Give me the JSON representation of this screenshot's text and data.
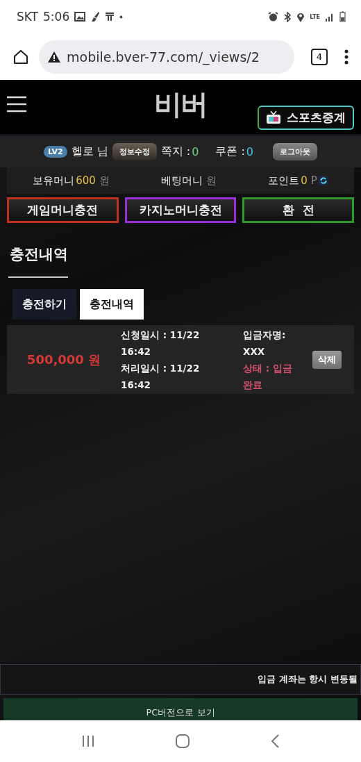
{
  "status_bar": {
    "carrier": "SKT",
    "time": "5:06",
    "network": "LTE"
  },
  "browser": {
    "url": "mobile.bver-77.com/_views/2",
    "tab_count": "4"
  },
  "header": {
    "logo": "비버",
    "live_button": "스포츠중계"
  },
  "user_bar": {
    "level": "LV2",
    "name": "헬로 님",
    "edit_button": "정보수정",
    "messages_label": "쪽지 :",
    "messages_count": "0",
    "coupons_label": "쿠폰 :",
    "coupons_count": "0",
    "logout_button": "로그아웃"
  },
  "balances": [
    {
      "label": "보유머니",
      "value": "600",
      "unit": "원",
      "refresh": false
    },
    {
      "label": "베팅머니",
      "unit": "원",
      "refresh": false
    },
    {
      "label": "포인트",
      "value": "0",
      "unit": "P",
      "refresh": true
    }
  ],
  "actions": [
    {
      "label": "게임머니충전",
      "color": "#c0321e"
    },
    {
      "label": "카지노머니충전",
      "color": "#9b2fd6"
    },
    {
      "label": "환  전",
      "color": "#2f9a2a"
    }
  ],
  "section_title": "충전내역",
  "tabs": [
    {
      "label": "충전하기",
      "selected": false
    },
    {
      "label": "충전내역",
      "selected": true
    }
  ],
  "records": [
    {
      "amount": "500,000 원",
      "requested": [
        "신청일시 : 11/22",
        "16:42"
      ],
      "processed": [
        "처리일시 : 11/22",
        "16:42"
      ],
      "depositor_label": "입금자명:",
      "depositor": "XXX",
      "status": [
        "상태 : 입금",
        "완료"
      ],
      "delete_button": "삭제"
    }
  ],
  "notice": "입금 계좌는 항시 변동될",
  "pc_button": "PC버전으로 보기"
}
